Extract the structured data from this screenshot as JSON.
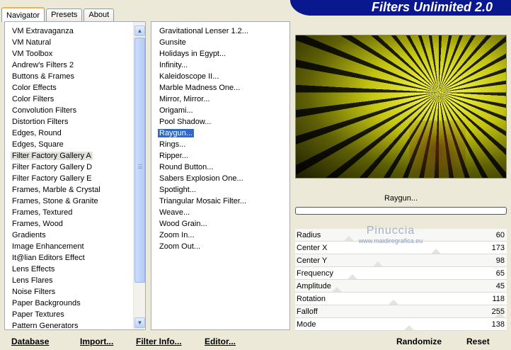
{
  "tabs": [
    {
      "label": "Navigator",
      "active": true
    },
    {
      "label": "Presets",
      "active": false
    },
    {
      "label": "About",
      "active": false
    }
  ],
  "banner": {
    "title": "Filters Unlimited 2.0"
  },
  "categories": [
    "VM Extravaganza",
    "VM Natural",
    "VM Toolbox",
    "Andrew's Filters 2",
    "Buttons & Frames",
    "Color Effects",
    "Color Filters",
    "Convolution Filters",
    "Distortion Filters",
    "Edges, Round",
    "Edges, Square",
    "Filter Factory Gallery A",
    "Filter Factory Gallery D",
    "Filter Factory Gallery E",
    "Frames, Marble & Crystal",
    "Frames, Stone & Granite",
    "Frames, Textured",
    "Frames, Wood",
    "Gradients",
    "Image Enhancement",
    "It@lian Editors Effect",
    "Lens Effects",
    "Lens Flares",
    "Noise Filters",
    "Paper Backgrounds",
    "Paper Textures",
    "Pattern Generators"
  ],
  "selected_category": "Filter Factory Gallery A",
  "filters": [
    "Gravitational Lenser 1.2...",
    "Gunsite",
    "Holidays in Egypt...",
    "Infinity...",
    "Kaleidoscope II...",
    "Marble Madness One...",
    "Mirror, Mirror...",
    "Origami...",
    "Pool Shadow...",
    "Raygun...",
    "Rings...",
    "Ripper...",
    "Round Button...",
    "Sabers Explosion One...",
    "Spotlight...",
    "Triangular Mosaic Filter...",
    "Weave...",
    "Wood Grain...",
    "Zoom In...",
    "Zoom Out..."
  ],
  "selected_filter": "Raygun...",
  "preview": {
    "filter_name": "Raygun...",
    "progress": 0
  },
  "watermark": {
    "name": "Pinuccia",
    "url": "www.maidiregrafica.eu"
  },
  "params": [
    {
      "label": "Radius",
      "value": 60
    },
    {
      "label": "Center X",
      "value": 173
    },
    {
      "label": "Center Y",
      "value": 98
    },
    {
      "label": "Frequency",
      "value": 65
    },
    {
      "label": "Amplitude",
      "value": 45
    },
    {
      "label": "Rotation",
      "value": 118
    },
    {
      "label": "Falloff",
      "value": 255
    },
    {
      "label": "Mode",
      "value": 138
    }
  ],
  "param_max": 255,
  "buttons": {
    "database": "Database",
    "import": "Import...",
    "filter_info": "Filter Info...",
    "editor": "Editor...",
    "randomize": "Randomize",
    "reset": "Reset"
  },
  "scroll": {
    "up_icon": "arrow-up-icon",
    "down_icon": "arrow-down-icon"
  }
}
